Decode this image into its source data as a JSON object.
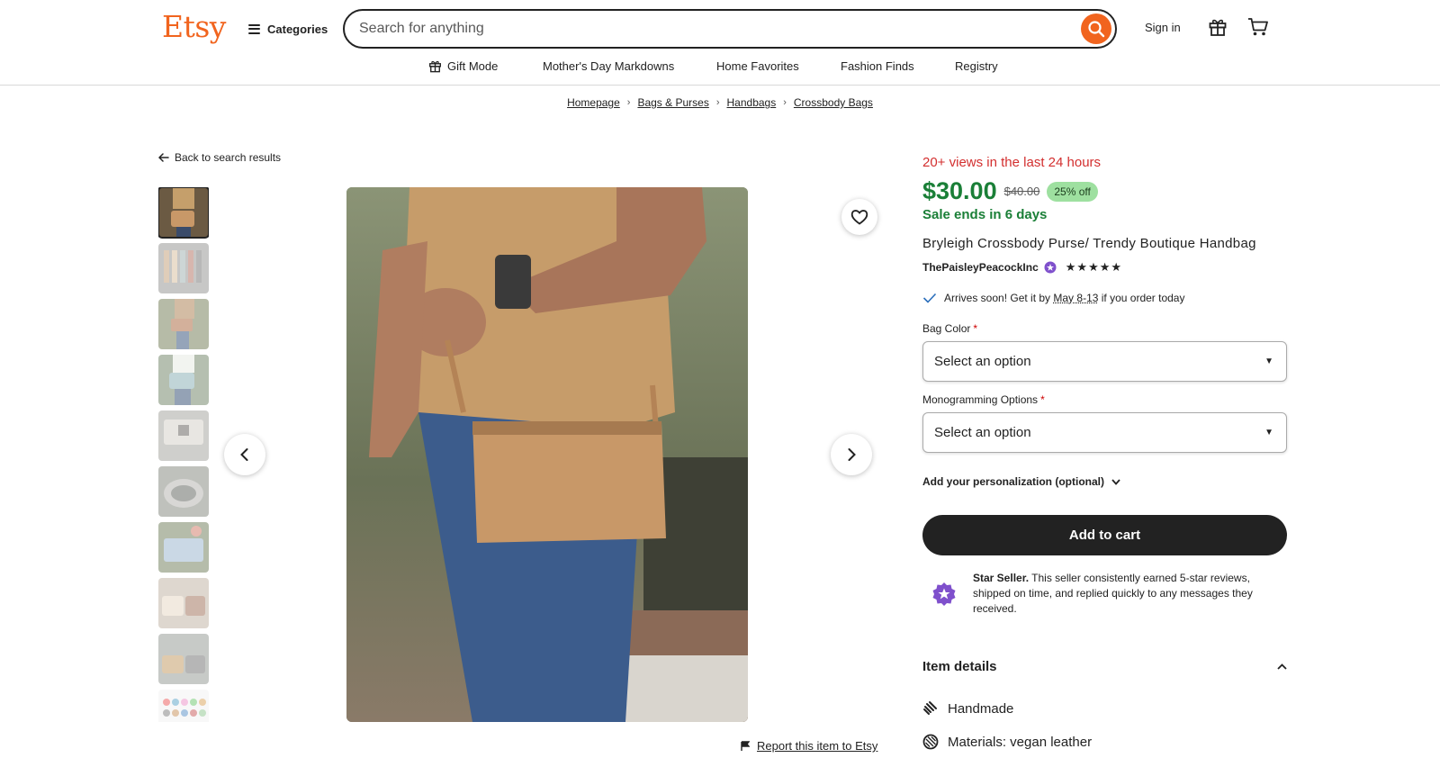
{
  "header": {
    "logo": "Etsy",
    "categories_label": "Categories",
    "search_placeholder": "Search for anything",
    "signin_label": "Sign in"
  },
  "subnav": {
    "items": [
      "Gift Mode",
      "Mother's Day Markdowns",
      "Home Favorites",
      "Fashion Finds",
      "Registry"
    ]
  },
  "breadcrumb": [
    "Homepage",
    "Bags & Purses",
    "Handbags",
    "Crossbody Bags"
  ],
  "gallery": {
    "back_label": "Back to search results",
    "report_label": "Report this item to Etsy"
  },
  "listing": {
    "views_text": "20+ views in the last 24 hours",
    "price": "$30.00",
    "original_price": "$40.00",
    "discount": "25% off",
    "sale_ends": "Sale ends in 6 days",
    "title": "Bryleigh Crossbody Purse/ Trendy Boutique Handbag",
    "shop_name": "ThePaisleyPeacockInc",
    "rating_stars": 5,
    "arrives_prefix": "Arrives soon! Get it by",
    "arrives_date": "May 8-13",
    "arrives_suffix": "if you order today"
  },
  "options": {
    "bag_color_label": "Bag Color",
    "bag_color_value": "Select an option",
    "monogram_label": "Monogramming Options",
    "monogram_value": "Select an option",
    "personalization_label": "Add your personalization (optional)"
  },
  "cart": {
    "add_to_cart_label": "Add to cart"
  },
  "star_seller": {
    "title": "Star Seller.",
    "text": "This seller consistently earned 5-star reviews, shipped on time, and replied quickly to any messages they received."
  },
  "item_details": {
    "heading": "Item details",
    "handmade": "Handmade",
    "materials": "Materials: vegan leather"
  },
  "colors": {
    "brand": "#f1641e",
    "price_green": "#1a7f37",
    "alert_red": "#d32f2f",
    "discount_bg": "#9ee0a0",
    "star_seller_purple": "#7f50cc"
  }
}
